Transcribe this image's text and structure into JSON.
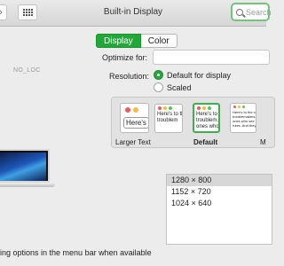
{
  "window": {
    "title": "Built-in Display"
  },
  "search": {
    "placeholder": "Search"
  },
  "tabs": [
    {
      "label": "Display"
    },
    {
      "label": "Color"
    }
  ],
  "noloc": "NO_LOC",
  "optimize": {
    "label": "Optimize for:"
  },
  "resolution": {
    "label": "Resolution:",
    "options": [
      {
        "label": "Default for display",
        "selected": true
      },
      {
        "label": "Scaled",
        "selected": false
      }
    ]
  },
  "scale": {
    "previews": {
      "larger": "Here's",
      "second": "Here's to the\ntroublem",
      "default": "Here's to th\ntroublem...\nones who s...",
      "more": "Here's to the cra\ntroublemakers. T\nones who see thi\nrules. And they"
    },
    "labels": {
      "larger": "Larger Text",
      "default": "Default",
      "more": "M"
    }
  },
  "resolution_list": [
    {
      "label": "1280 × 800",
      "selected": true
    },
    {
      "label": "1152 × 720",
      "selected": false
    },
    {
      "label": "1024 × 640",
      "selected": false
    }
  ],
  "menu_bar_option": "ing options in the menu bar when available",
  "colors": {
    "accent": "#22a839",
    "search_focus": "#71c679"
  }
}
